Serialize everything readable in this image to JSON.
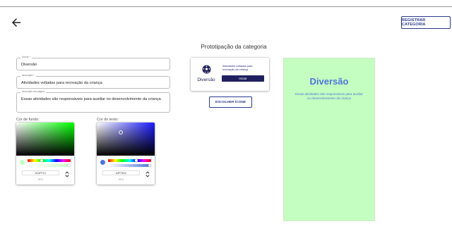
{
  "header": {
    "back_icon": "arrow-left-icon",
    "register_label": "REGISTRAR CATEGORIA"
  },
  "form": {
    "nome": {
      "label": "Nome *",
      "value": "Diversão"
    },
    "descricao": {
      "label": "descrição *",
      "value": "Atividades voltadas para recreação da criança"
    },
    "descricao_pagina": {
      "label": "descrição da página",
      "value": "Essas atividades são responsáveis para auxiliar no desenvolvimento da criança"
    }
  },
  "colors": {
    "background": {
      "label": "Cor de fundo:",
      "hex": "#C4FFC1",
      "format_label": "HEX",
      "hue_color": "#00ff00",
      "hue_level": 0.33,
      "swatch": "#c4ffc1",
      "toggle_icon": "chevron-updown-icon"
    },
    "text": {
      "label": "Cor do texto:",
      "hex": "#4F73DC",
      "format_label": "HEX",
      "hue_color": "#1a1aff",
      "hue_level": 0.65,
      "swatch": "#4f73dc",
      "toggle_icon": "chevron-updown-icon"
    }
  },
  "prototype": {
    "title": "Prototipação da categoria",
    "card": {
      "icon": "soccer-ball-icon",
      "name": "Diversão",
      "description": "Atividades voltadas para recreação da criança",
      "button_label": "Iniciar",
      "button_color": "#21215f"
    },
    "choose_icon_label": "ESCOLHER ÍCONE",
    "preview": {
      "title": "Diversão",
      "description": "Essas atividades são responsáveis para auxiliar no desenvolvimento da criança",
      "background": "#c4ffc1",
      "text_color": "#4f73dc"
    }
  }
}
